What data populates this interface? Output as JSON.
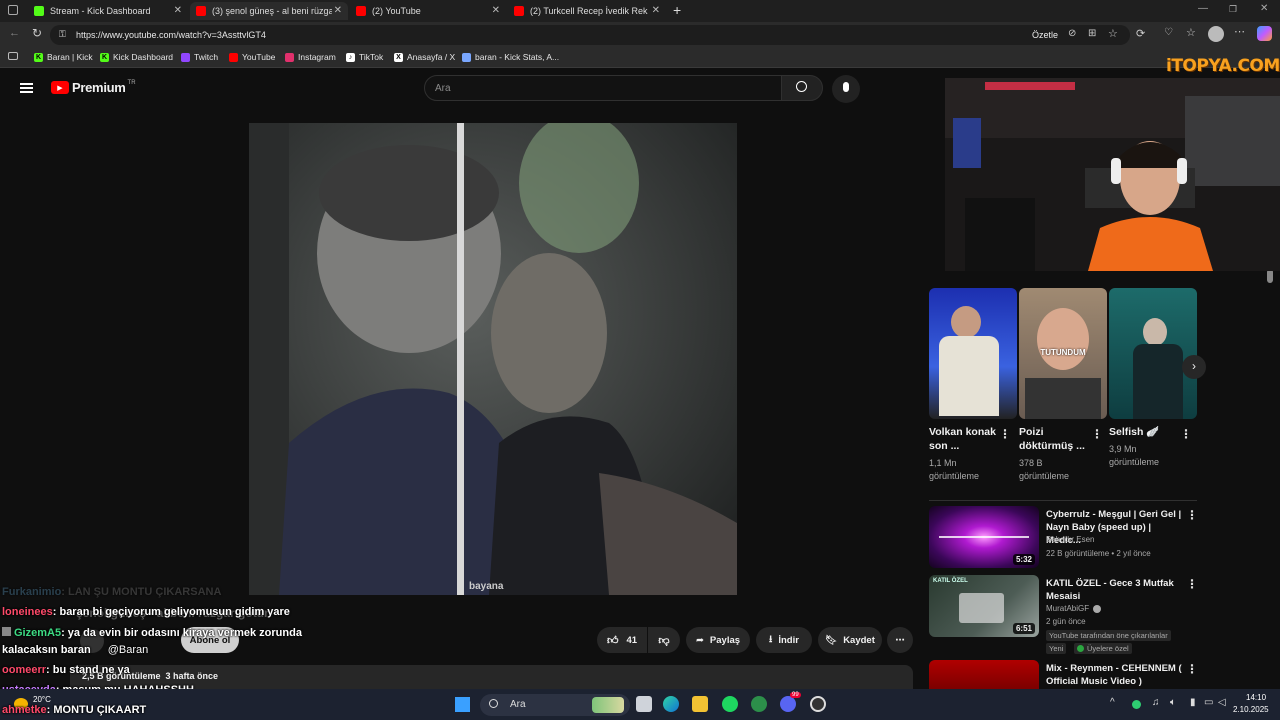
{
  "browser": {
    "tabs": [
      {
        "title": "Stream - Kick Dashboard",
        "color": "#53fc18"
      },
      {
        "title": "(3) şenol güneş - al beni rüzgar g",
        "color": "#ff0000"
      },
      {
        "title": "(2) YouTube",
        "color": "#ff0000"
      },
      {
        "title": "(2) Turkcell Recep İvedik Reklam",
        "color": "#ff0000"
      }
    ],
    "url": "https://www.youtube.com/watch?v=3AssttvlGT4",
    "summarize_label": "Özetle",
    "bookmarks": [
      {
        "label": "Baran | Kick",
        "icon": "kick-icon",
        "color": "#53fc18"
      },
      {
        "label": "Kick Dashboard",
        "icon": "kick-icon",
        "color": "#53fc18"
      },
      {
        "label": "Twitch",
        "icon": "twitch-icon",
        "color": "#9146ff"
      },
      {
        "label": "YouTube",
        "icon": "youtube-icon",
        "color": "#ff0000"
      },
      {
        "label": "Instagram",
        "icon": "instagram-icon",
        "color": "#e1306c"
      },
      {
        "label": "TikTok",
        "icon": "tiktok-icon",
        "color": "#ffffff"
      },
      {
        "label": "Anasayfa / X",
        "icon": "x-icon",
        "color": "#ffffff"
      },
      {
        "label": "baran - Kick Stats, A...",
        "icon": "stats-icon",
        "color": "#7aa7ff"
      }
    ]
  },
  "youtube": {
    "logo_text": "Premium",
    "logo_region": "TR",
    "search_placeholder": "Ara",
    "channel_subscribe": "Abone ol",
    "channel_mention": "@Baran",
    "actions": {
      "likes": "41",
      "share": "Paylaş",
      "download": "İndir",
      "save": "Kaydet"
    },
    "views_line": "2,5 B görüntüleme  3 hafta önce",
    "video_watermark": "bayana",
    "shorts": [
      {
        "title": "Volkan konak son ...",
        "views": "1,1 Mn görüntüleme"
      },
      {
        "title": "Poizi döktürmüş ...",
        "views": "378 B görüntüleme",
        "overlay": "TUTUNDUM"
      },
      {
        "title": "Selfish 🪽",
        "views": "3,9 Mn görüntüleme"
      }
    ],
    "recommendations": [
      {
        "title": "Cyberrulz - Meşgul | Geri Gel | Nayn Baby (speed up) | Medic...",
        "channel": "Bahadır Esen",
        "meta": "22 B görüntüleme • 2 yıl önce",
        "duration": "5:32"
      },
      {
        "title": "KATIL ÖZEL - Gece 3 Mutfak Mesaisi",
        "channel": "MuratAbiGF",
        "meta": "2 gün önce",
        "duration": "6:51",
        "badge1": "YouTube tarafından öne çıkarılanlar",
        "badge2": "Yeni",
        "badge3": "Üyelere özel",
        "thumb_text": "KATIL ÖZEL"
      },
      {
        "title": "Mix - Reynmen - CEHENNEM ( Official Music Video )",
        "channel": "",
        "meta": "",
        "duration": ""
      }
    ]
  },
  "overlay": {
    "watermark": "iTOPYA.COM",
    "chat": [
      {
        "user": "Furkanimio",
        "text": ": LAN ŞU MONTU ÇIKARSANA",
        "color": "#4a7a9a"
      },
      {
        "user": "loneinees",
        "text": ": baran bi geçiyorum geliyomusun gidim yare",
        "color": "#ff4a6a"
      },
      {
        "user": "GizemA5",
        "text": ": ya da evin bir odasını kiraya vermek zorunda",
        "color": "#3ddc84"
      },
      {
        "user": "",
        "text": "kalacaksın baran",
        "color": "#ffffff"
      },
      {
        "user": "oomeerr",
        "text": ": bu stand ne ya",
        "color": "#ff4a6a"
      },
      {
        "user": "ustaceyda",
        "text": ": masum mu HAHAHSSHH",
        "color": "#c77dff"
      },
      {
        "user": "ahmetke",
        "text": ": MONTU ÇIKAART",
        "color": "#ff4a6a"
      }
    ],
    "video_caption_ghost": "şenol güneş - al beni rüzgar götür"
  },
  "taskbar": {
    "weather_temp": "20°C",
    "search": "Ara",
    "time": "14:10",
    "date": "2.10.2025",
    "badge": "99"
  }
}
